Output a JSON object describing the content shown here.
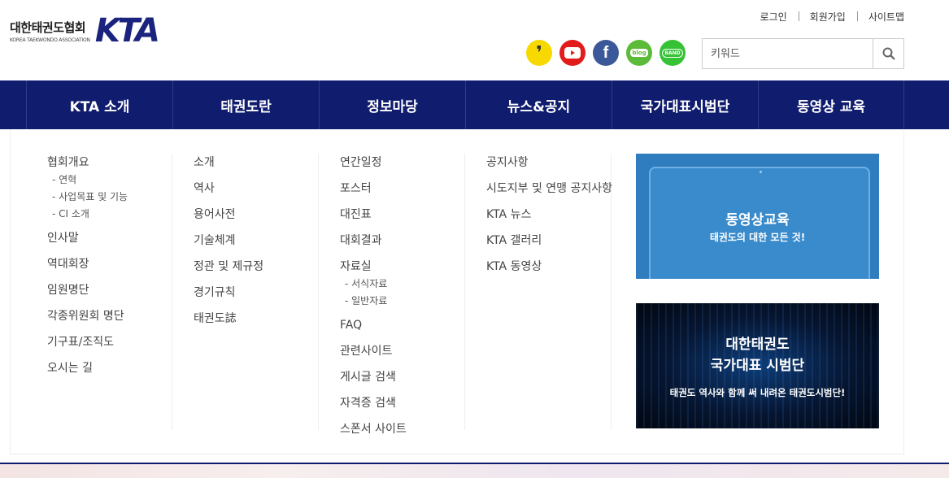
{
  "logo": {
    "korean": "대한태권도협회",
    "english": "KOREA TAEKWONDO ASSOCIATION",
    "mark": "KTA"
  },
  "util_links": [
    "로그인",
    "회원가입",
    "사이트맵"
  ],
  "sns": {
    "kakao_icon": "kakao-story-icon",
    "youtube_icon": "youtube-icon",
    "facebook_label": "f",
    "blog_label": "blog",
    "band_label": "BAND"
  },
  "search": {
    "placeholder": "키워드",
    "icon": "search-icon"
  },
  "nav": [
    "KTA 소개",
    "태권도란",
    "정보마당",
    "뉴스&공지",
    "국가대표시범단",
    "동영상 교육"
  ],
  "mega": {
    "col1": {
      "item1": "협회개요",
      "sub": [
        "- 연혁",
        "- 사업목표 및 기능",
        "- CI 소개"
      ],
      "items": [
        "인사말",
        "역대회장",
        "임원명단",
        "각종위원회 명단",
        "기구표/조직도",
        "오시는 길"
      ]
    },
    "col2": {
      "items": [
        "소개",
        "역사",
        "용어사전",
        "기술체계",
        "정관 및 제규정",
        "경기규칙",
        "태권도誌"
      ]
    },
    "col3": {
      "items_before": [
        "연간일정",
        "포스터",
        "대진표",
        "대회결과",
        "자료실"
      ],
      "sub": [
        "- 서식자료",
        "- 일반자료"
      ],
      "items_after": [
        "FAQ",
        "관련사이트",
        "게시글 검색",
        "자격증 검색",
        "스폰서 사이트"
      ]
    },
    "col4": {
      "items": [
        "공지사항",
        "시도지부 및 연맹 공지사항",
        "KTA 뉴스",
        "KTA 갤러리",
        "KTA 동영상"
      ]
    }
  },
  "banner_video": {
    "title": "동영상교육",
    "subtitle": "태권도의 대한 모든 것!"
  },
  "banner_demo": {
    "title_line1": "대한태권도",
    "title_line2": "국가대표 시범단",
    "subtitle": "태권도 역사와 함께 써 내려온 태권도시범단!"
  },
  "colors": {
    "nav_bg": "#101c6e",
    "brand": "#1a237e",
    "banner_blue": "#2f7cbf"
  }
}
